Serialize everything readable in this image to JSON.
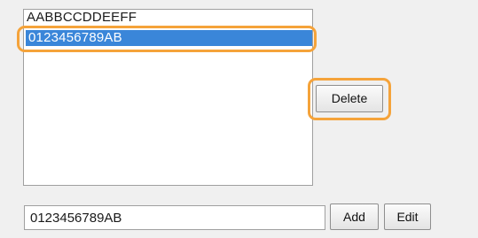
{
  "listbox": {
    "items": [
      {
        "label": "AABBCCDDEEFF",
        "selected": false
      },
      {
        "label": "0123456789AB",
        "selected": true
      }
    ]
  },
  "buttons": {
    "delete_label": "Delete",
    "add_label": "Add",
    "edit_label": "Edit"
  },
  "input": {
    "value": "0123456789AB"
  },
  "colors": {
    "selection": "#3a86d9",
    "highlight": "#f5a33a"
  }
}
